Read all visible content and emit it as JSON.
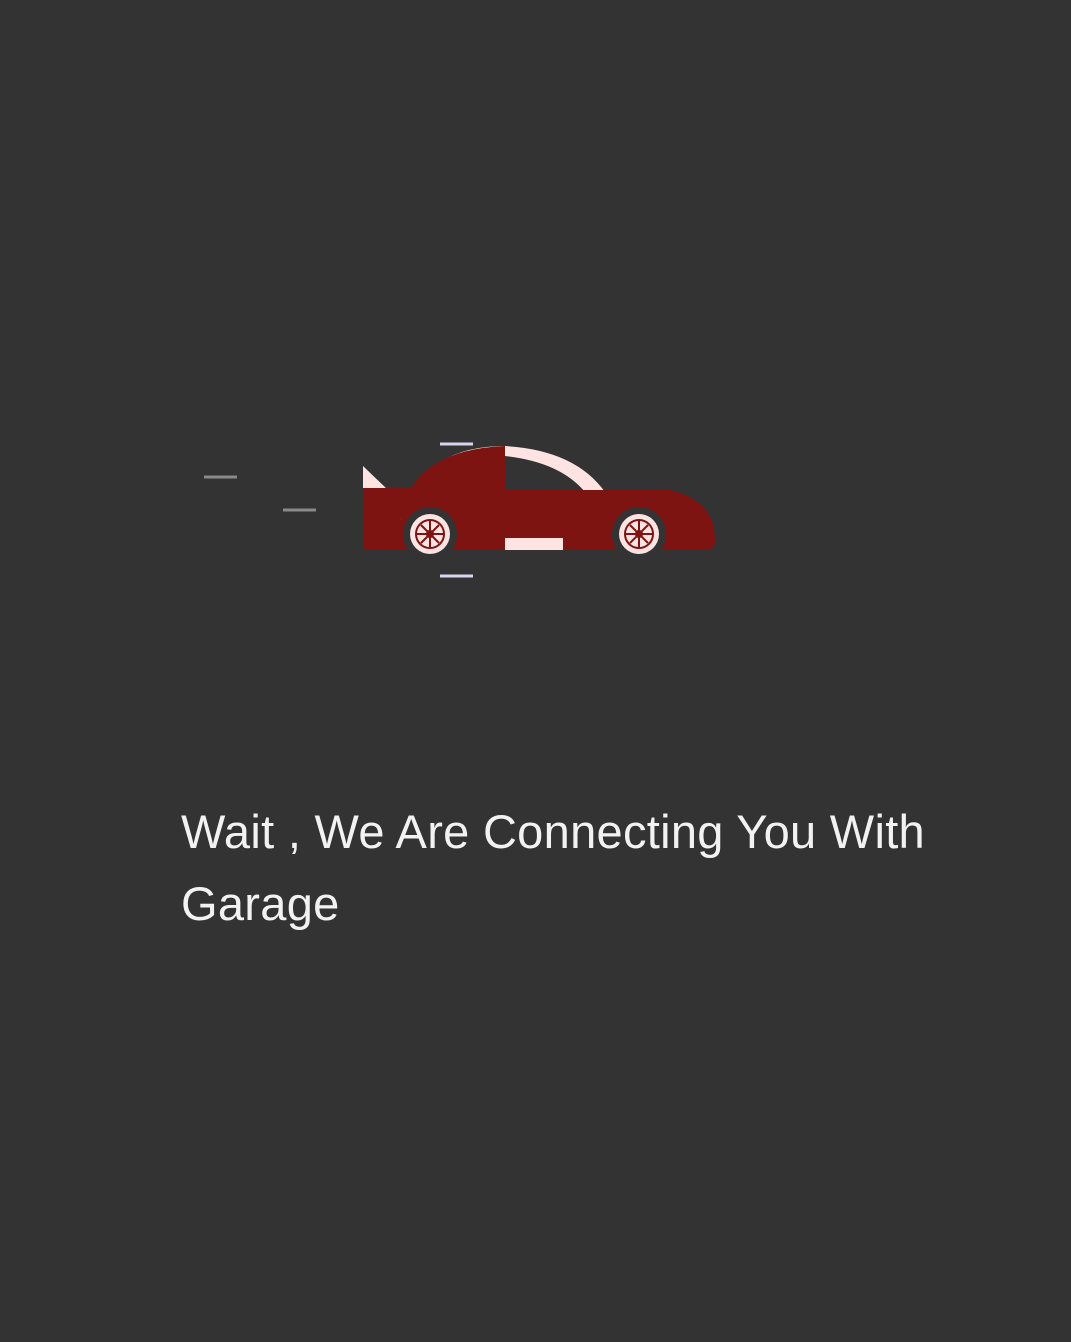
{
  "loader": {
    "message": "Wait , We Are Connecting You With Garage",
    "illustration_icon": "moving-car-icon"
  },
  "colors": {
    "background": "#333333",
    "text": "#f2f2f2",
    "car_body": "#7d1411",
    "car_accent": "#fde3e1",
    "speed_line": "#8a8a8a",
    "motion_line": "#d9d4f0"
  }
}
